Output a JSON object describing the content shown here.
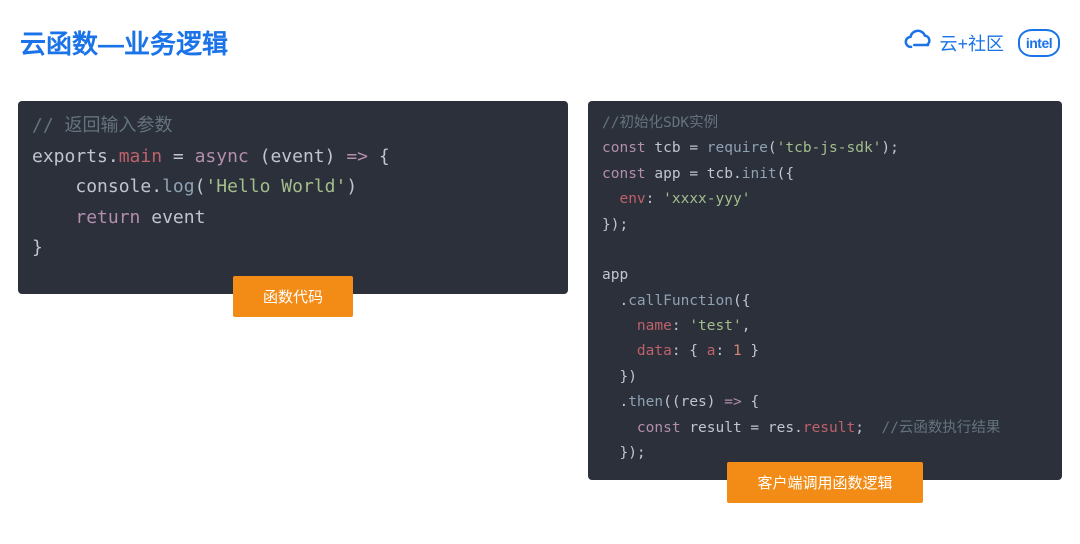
{
  "header": {
    "title": "云函数—业务逻辑",
    "community_label": "云+社区",
    "intel_label": "intel"
  },
  "color": {
    "primary": "#1a73e8",
    "badge_bg": "#f28c17",
    "code_bg": "#2b303b"
  },
  "left_block": {
    "badge": "函数代码",
    "code": {
      "l1_comment": "// 返回输入参数",
      "l2_exports": "exports",
      "l2_dot": ".",
      "l2_main": "main",
      "l2_eq": " = ",
      "l2_async": "async",
      "l2_params": " (",
      "l2_event": "event",
      "l2_params2": ") ",
      "l2_arrow": "=>",
      "l2_brace": " {",
      "l3_indent": "    ",
      "l3_console": "console",
      "l3_dot": ".",
      "l3_log": "log",
      "l3_paren": "(",
      "l3_str": "'Hello World'",
      "l3_paren2": ")",
      "l4_indent": "    ",
      "l4_return": "return",
      "l4_sp": " ",
      "l4_event": "event",
      "l5_brace": "}"
    }
  },
  "right_block": {
    "badge": "客户端调用函数逻辑",
    "code": {
      "l1_comment": "//初始化SDK实例",
      "l2_const": "const",
      "l2_sp": " ",
      "l2_tcb": "tcb",
      "l2_eq": " = ",
      "l2_require": "require",
      "l2_p1": "(",
      "l2_str": "'tcb-js-sdk'",
      "l2_p2": ");",
      "l3_const": "const",
      "l3_sp": " ",
      "l3_app": "app",
      "l3_eq": " = ",
      "l3_tcb": "tcb",
      "l3_dot": ".",
      "l3_init": "init",
      "l3_p": "({",
      "l4_indent": "  ",
      "l4_env": "env",
      "l4_colon": ": ",
      "l4_str": "'xxxx-yyy'",
      "l5": "});",
      "blank1": "",
      "l7_app": "app",
      "l8_indent": "  .",
      "l8_call": "callFunction",
      "l8_p": "({",
      "l9_indent": "    ",
      "l9_name": "name",
      "l9_colon": ": ",
      "l9_str": "'test'",
      "l9_comma": ",",
      "l10_indent": "    ",
      "l10_data": "data",
      "l10_colon": ": { ",
      "l10_a": "a",
      "l10_colon2": ": ",
      "l10_num": "1",
      "l10_close": " }",
      "l11": "  })",
      "l12_indent": "  .",
      "l12_then": "then",
      "l12_p1": "((",
      "l12_res": "res",
      "l12_p2": ") ",
      "l12_arrow": "=>",
      "l12_brace": " {",
      "l13_indent": "    ",
      "l13_const": "const",
      "l13_sp": " ",
      "l13_result": "result",
      "l13_eq": " = ",
      "l13_res": "res",
      "l13_dot": ".",
      "l13_resultp": "result",
      "l13_semi": ";  ",
      "l13_comment": "//云函数执行结果",
      "l14": "  });"
    }
  }
}
